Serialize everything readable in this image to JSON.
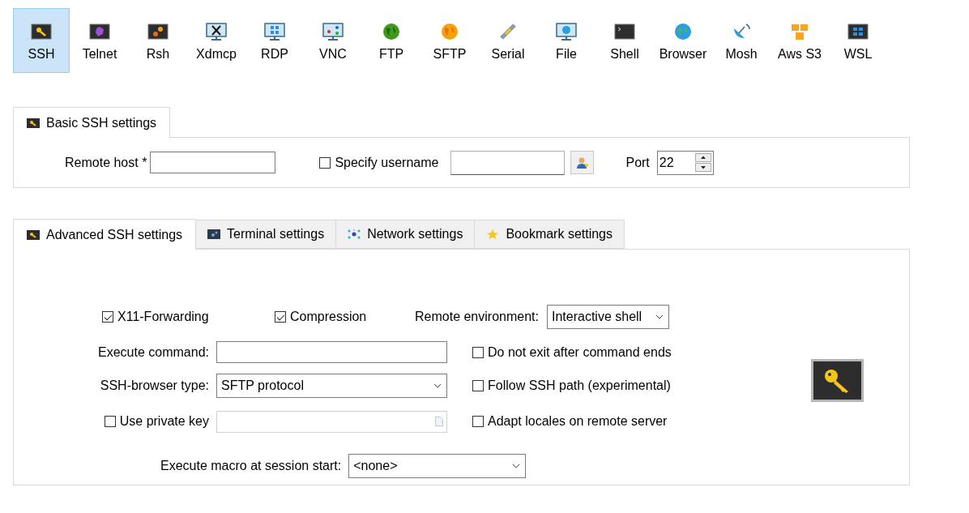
{
  "session_types": [
    {
      "label": "SSH",
      "kind": "ssh",
      "selected": true
    },
    {
      "label": "Telnet",
      "kind": "telnet",
      "selected": false
    },
    {
      "label": "Rsh",
      "kind": "rsh",
      "selected": false
    },
    {
      "label": "Xdmcp",
      "kind": "xdmcp",
      "selected": false
    },
    {
      "label": "RDP",
      "kind": "rdp",
      "selected": false
    },
    {
      "label": "VNC",
      "kind": "vnc",
      "selected": false
    },
    {
      "label": "FTP",
      "kind": "ftp",
      "selected": false
    },
    {
      "label": "SFTP",
      "kind": "sftp",
      "selected": false
    },
    {
      "label": "Serial",
      "kind": "serial",
      "selected": false
    },
    {
      "label": "File",
      "kind": "file",
      "selected": false
    },
    {
      "label": "Shell",
      "kind": "shell",
      "selected": false
    },
    {
      "label": "Browser",
      "kind": "browser",
      "selected": false
    },
    {
      "label": "Mosh",
      "kind": "mosh",
      "selected": false
    },
    {
      "label": "Aws S3",
      "kind": "s3",
      "selected": false
    },
    {
      "label": "WSL",
      "kind": "wsl",
      "selected": false
    }
  ],
  "basic": {
    "tab": {
      "label": "Basic SSH settings"
    },
    "remote_host": {
      "label": "Remote host *"
    },
    "specify_username": {
      "label": "Specify username",
      "checked": false
    },
    "port": {
      "label": "Port",
      "value": "22"
    }
  },
  "advanced_tabs": [
    {
      "label": "Advanced SSH settings",
      "kind": "key",
      "selected": true
    },
    {
      "label": "Terminal settings",
      "kind": "terminal",
      "selected": false
    },
    {
      "label": "Network settings",
      "kind": "network",
      "selected": false
    },
    {
      "label": "Bookmark settings",
      "kind": "star",
      "selected": false
    }
  ],
  "advanced": {
    "x11_forwarding": {
      "label": "X11-Forwarding",
      "checked": true
    },
    "compression": {
      "label": "Compression",
      "checked": true
    },
    "remote_environment": {
      "label": "Remote environment:",
      "value": "Interactive shell"
    },
    "execute_command": {
      "label": "Execute command:"
    },
    "ssh_browser_type": {
      "label": "SSH-browser type:",
      "value": "SFTP protocol"
    },
    "use_private_key": {
      "label": "Use private key",
      "checked": false
    },
    "options": [
      {
        "label": "Do not exit after command ends",
        "checked": false
      },
      {
        "label": "Follow SSH path (experimental)",
        "checked": false
      },
      {
        "label": "Adapt locales on remote server",
        "checked": false
      }
    ],
    "execute_macro": {
      "label": "Execute macro at session start:",
      "value": "<none>"
    }
  }
}
